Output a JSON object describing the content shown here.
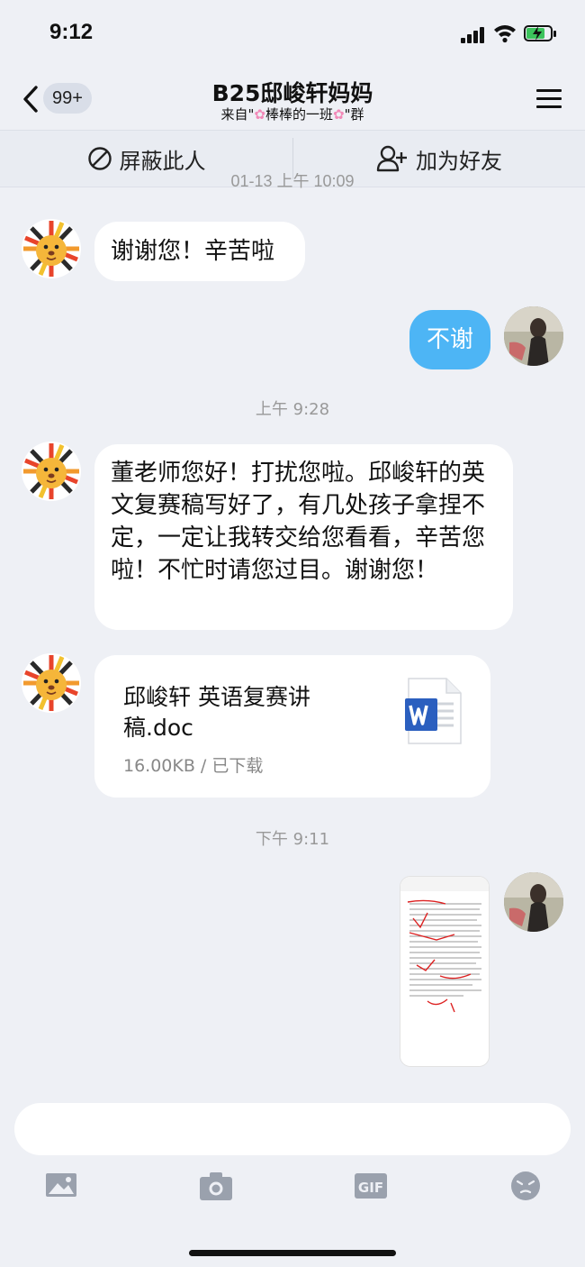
{
  "status": {
    "time": "9:12"
  },
  "nav": {
    "back_badge": "99+",
    "title": "B25邸峻轩妈妈",
    "subtitle_prefix": "来自\"",
    "group_name": "棒棒的一班",
    "subtitle_suffix": "\"群"
  },
  "actions": {
    "block_label": "屏蔽此人",
    "add_friend_label": "加为好友"
  },
  "chat": {
    "clipped_timestamp": "01-13 上午 10:09",
    "messages": [
      {
        "text": "谢谢您！辛苦啦"
      },
      {
        "text": "不谢"
      },
      {
        "text": "董老师您好！打扰您啦。邱峻轩的英文复赛稿写好了，有几处孩子拿捏不定，一定让我转交给您看看，辛苦您啦！不忙时请您过目。谢谢您！"
      }
    ],
    "timestamp_1": "上午 9:28",
    "timestamp_2": "下午 9:11",
    "file": {
      "name": "邱峻轩 英语复赛讲稿.doc",
      "meta": "16.00KB / 已下载"
    }
  },
  "colors": {
    "accent_blue": "#4DB5F5",
    "background": "#EEF0F5",
    "word_blue": "#2B5FBF"
  },
  "icons": {
    "block": "block-icon",
    "add_friend": "add-friend-icon",
    "image": "image-icon",
    "camera": "camera-icon",
    "gif": "gif-icon",
    "emoji": "emoji-icon",
    "word": "word-doc-icon"
  }
}
